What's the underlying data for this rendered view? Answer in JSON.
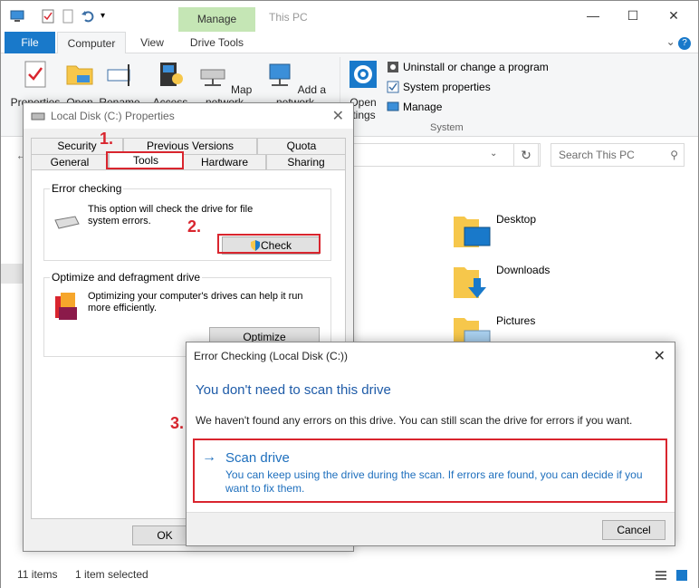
{
  "explorer": {
    "title": "This PC",
    "context_tab": "Manage",
    "tabs": [
      "File",
      "Computer",
      "View",
      "Drive Tools"
    ],
    "ribbon_buttons": [
      "Properties",
      "Open",
      "Rename",
      "Access",
      "Map network",
      "Add a network",
      "Open"
    ],
    "open_settings_partial": "ettings",
    "system_items": [
      "Uninstall or change a program",
      "System properties",
      "Manage"
    ],
    "system_group_label": "System",
    "search_placeholder": "Search This PC",
    "folders": [
      "Desktop",
      "Downloads",
      "Pictures"
    ],
    "status": {
      "items": "11 items",
      "selected": "1 item selected"
    },
    "colors": {
      "file_tab": "#1979ca",
      "manage_tab": "#c5e6b5",
      "annotation_red": "#d9252e",
      "link_blue": "#1e6fbd"
    }
  },
  "properties_dialog": {
    "title": "Local Disk (C:) Properties",
    "tabs_row1": [
      "Security",
      "Previous Versions",
      "Quota"
    ],
    "tabs_row2": [
      "General",
      "Tools",
      "Hardware",
      "Sharing"
    ],
    "selected_tab": "Tools",
    "error_checking": {
      "label": "Error checking",
      "text_line1": "This option will check the drive for file",
      "text_line2": "system errors.",
      "button": "Check"
    },
    "optimize": {
      "label": "Optimize and defragment drive",
      "text_line1": "Optimizing your computer's drives can help it run",
      "text_line2": "more efficiently.",
      "button": "Optimize"
    },
    "ok_button": "OK"
  },
  "annotations": {
    "step1": "1.",
    "step2": "2.",
    "step3": "3."
  },
  "error_dialog": {
    "title": "Error Checking (Local Disk (C:))",
    "heading": "You don't need to scan this drive",
    "body": "We haven't found any errors on this drive. You can still scan the drive for errors if you want.",
    "scan_arrow": "→",
    "scan_title": "Scan drive",
    "scan_desc_line1": "You can keep using the drive during the scan. If errors are found, you can decide if you",
    "scan_desc_line2": "want to fix them.",
    "cancel_button": "Cancel"
  }
}
